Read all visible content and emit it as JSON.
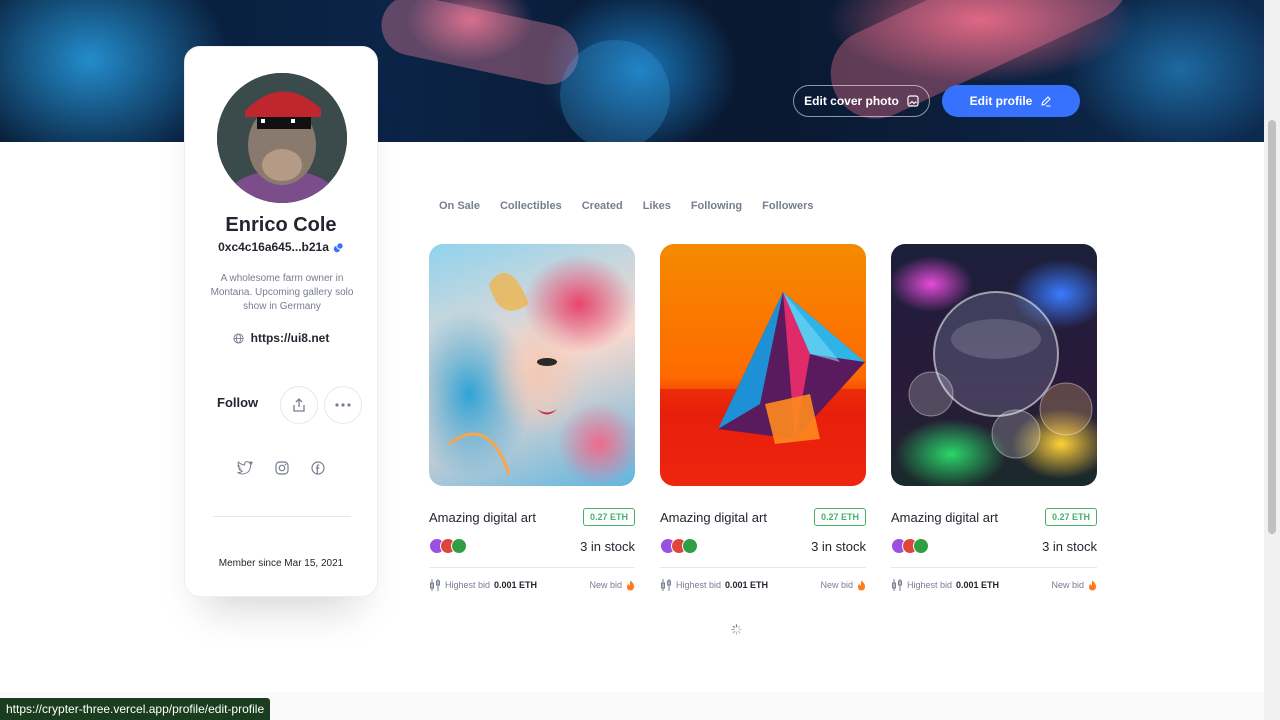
{
  "header": {
    "edit_cover_label": "Edit cover photo",
    "edit_profile_label": "Edit profile",
    "accent_color": "#3772ff"
  },
  "profile": {
    "name": "Enrico Cole",
    "wallet": "0xc4c16a645...b21a",
    "bio": "A wholesome farm owner in Montana. Upcoming gallery solo show in Germany",
    "website": "https://ui8.net",
    "follow_label": "Follow",
    "member_since": "Member since Mar 15, 2021",
    "icons": [
      "globe-icon",
      "share-icon",
      "more-icon",
      "twitter-icon",
      "instagram-icon",
      "facebook-icon"
    ]
  },
  "tabs": [
    "On Sale",
    "Collectibles",
    "Created",
    "Likes",
    "Following",
    "Followers"
  ],
  "items": [
    {
      "title": "Amazing digital art",
      "price": "0.27 ETH",
      "stock": "3 in stock",
      "bid_label": "Highest bid",
      "bid_value": "0.001 ETH",
      "new_bid_label": "New bid"
    },
    {
      "title": "Amazing digital art",
      "price": "0.27 ETH",
      "stock": "3 in stock",
      "bid_label": "Highest bid",
      "bid_value": "0.001 ETH",
      "new_bid_label": "New bid"
    },
    {
      "title": "Amazing digital art",
      "price": "0.27 ETH",
      "stock": "3 in stock",
      "bid_label": "Highest bid",
      "bid_value": "0.001 ETH",
      "new_bid_label": "New bid"
    }
  ],
  "status_url": "https://crypter-three.vercel.app/profile/edit-profile",
  "colors": {
    "price_green": "#45b26b",
    "text_dark": "#23262f",
    "text_muted": "#777e90"
  }
}
